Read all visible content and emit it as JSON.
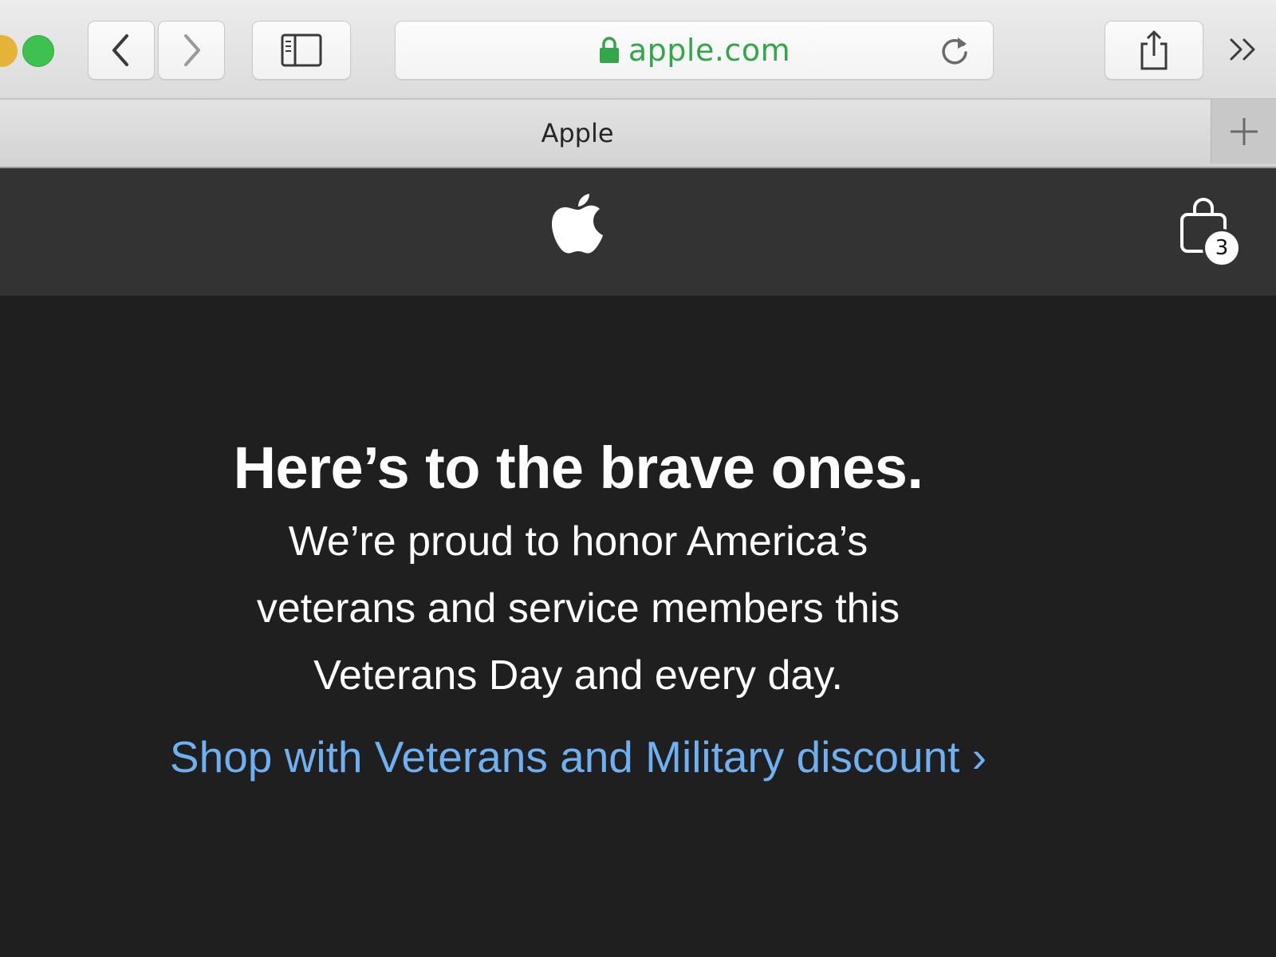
{
  "toolbar": {
    "address": "apple.com",
    "accent_secure": "#33a64a"
  },
  "tab": {
    "title": "Apple"
  },
  "nav": {
    "bag_count": "3"
  },
  "hero": {
    "headline": "Here’s to the brave ones.",
    "subhead": "We’re proud to honor America’s veterans and service members this Veterans Day and every day.",
    "cta": "Shop with Veterans and Military discount ›",
    "link_color": "#6fb0f2",
    "background": "#1f1f1f"
  }
}
